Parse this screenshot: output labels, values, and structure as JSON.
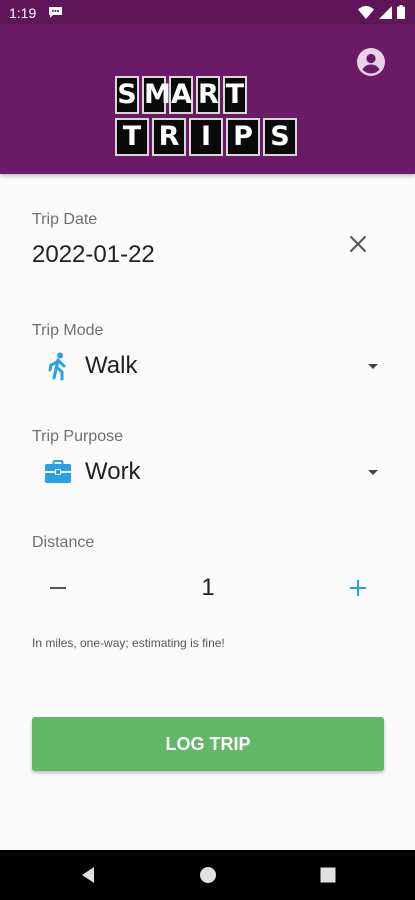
{
  "status_bar": {
    "time": "1:19"
  },
  "header": {
    "logo_line1": [
      "S",
      "M",
      "A",
      "R",
      "T"
    ],
    "logo_line2": [
      "T",
      "R",
      "I",
      "P",
      "S"
    ],
    "brand_color": "#6b1a66"
  },
  "form": {
    "trip_date": {
      "label": "Trip Date",
      "value": "2022-01-22"
    },
    "trip_mode": {
      "label": "Trip Mode",
      "value": "Walk",
      "icon": "walk-icon"
    },
    "trip_purpose": {
      "label": "Trip Purpose",
      "value": "Work",
      "icon": "briefcase-icon"
    },
    "distance": {
      "label": "Distance",
      "value": "1",
      "hint": "In miles, one-way; estimating is fine!"
    }
  },
  "actions": {
    "log_trip_label": "LOG TRIP",
    "button_color": "#64b668"
  },
  "colors": {
    "accent": "#2aa0e8"
  }
}
